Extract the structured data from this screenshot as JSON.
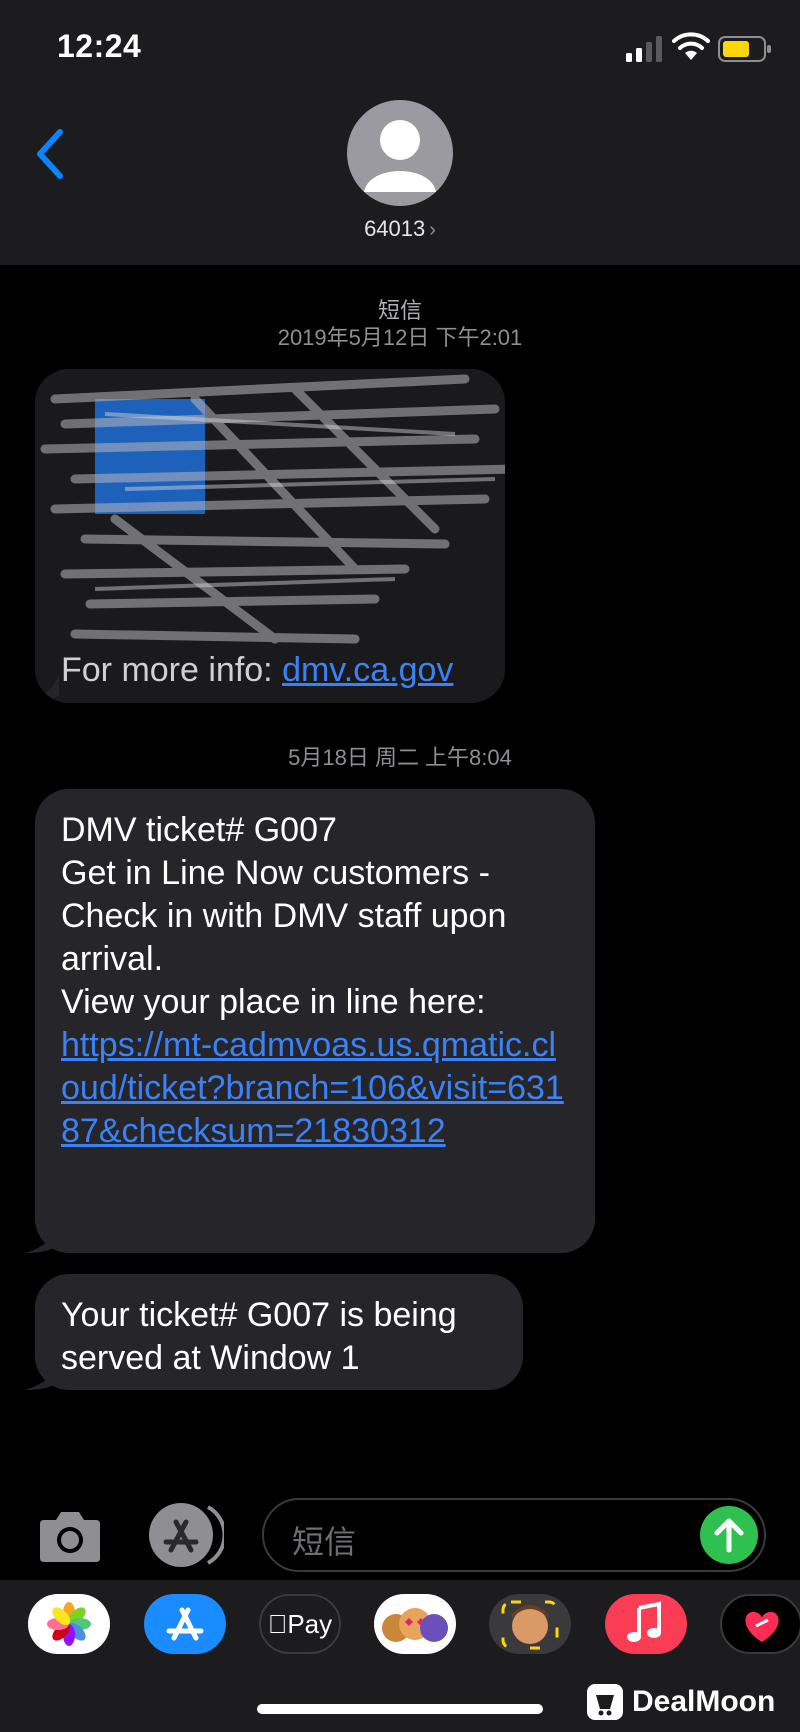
{
  "status_bar": {
    "time": "12:24",
    "colors": {
      "battery": "#ffd60a"
    }
  },
  "header": {
    "contact": "64013",
    "chevron": "›",
    "icons": [
      "back-chevron-icon",
      "contact-avatar-icon"
    ]
  },
  "conversation": {
    "service_label": "短信",
    "timestamp_1": "2019年5月12日 下午2:01",
    "message_1": {
      "visible_prefix": "For more info: ",
      "link": "dmv.ca.gov",
      "note": ""
    },
    "timestamp_2": "5月18日 周二 上午8:04",
    "message_2": {
      "line1": "DMV ticket# G007",
      "line2": "Get in Line Now customers -",
      "line3": "Check in with DMV staff upon",
      "line4": "arrival.",
      "line5": "View your place in line here:",
      "link": "https://mt-cadmvoas.us.qmatic.cloud/ticket?branch=106&visit=63187&checksum=21830312"
    },
    "message_3": {
      "line1": "Your ticket# G007 is being",
      "line2": "served at Window 1"
    }
  },
  "input": {
    "placeholder": "短信"
  },
  "app_tray": {
    "apps": [
      "photos-icon",
      "app-store-icon",
      "apple-pay-icon",
      "memoji-stickers-icon",
      "memoji-icon",
      "music-icon",
      "fitness-icon"
    ],
    "apple_pay_label": "Pay",
    "watermark": "DealMoon"
  },
  "colors": {
    "accent": "#0a84ff",
    "send": "#30c04f",
    "bubble": "#26252a",
    "header": "#1c1c1e"
  }
}
